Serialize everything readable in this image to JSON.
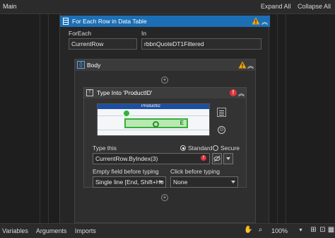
{
  "topbar": {
    "title": "Main",
    "expand_all": "Expand All",
    "collapse_all": "Collapse All"
  },
  "foreach": {
    "title": "For Each Row in Data Table",
    "foreach_label": "ForEach",
    "foreach_value": "CurrentRow",
    "in_label": "In",
    "in_value": "rbbnQuoteDT1Filtered"
  },
  "body": {
    "title": "Body"
  },
  "typeinto": {
    "title": "Type Into 'ProductID'",
    "preview_header": "ProductID",
    "preview_marker": "E",
    "type_this_label": "Type this",
    "radio_standard": "Standard",
    "radio_secure": "Secure",
    "type_value": "CurrentRow.ByIndex(3)",
    "empty_field_label": "Empty field before typing",
    "empty_field_value": "Single line [End, Shift+Ho",
    "click_before_label": "Click before typing",
    "click_before_value": "None"
  },
  "bottombar": {
    "tabs": [
      "Variables",
      "Arguments",
      "Imports"
    ],
    "zoom": "100%"
  },
  "colors": {
    "activity_header": "#1d6fb5",
    "error": "#e0323a",
    "warning": "#f0a30a",
    "target_green": "#38b03a"
  },
  "icons": [
    "foreach-icon",
    "warning-icon",
    "collapse-chevron-icon",
    "body-icon",
    "type-into-icon",
    "error-icon",
    "menu-icon",
    "scope-icon",
    "secure-toggle-icon",
    "dropdown-icon",
    "plus-icon",
    "hand-icon",
    "zoom-icon",
    "fit-icon",
    "expand-icon",
    "overview-icon"
  ]
}
